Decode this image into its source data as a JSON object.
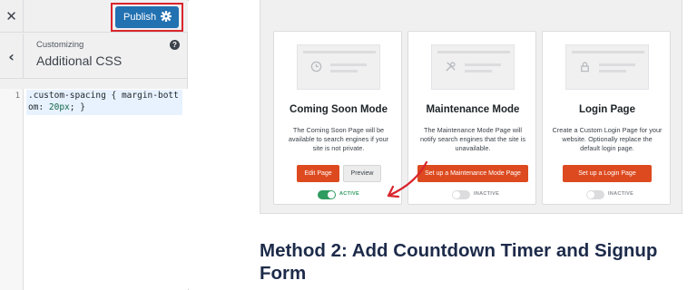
{
  "customizer": {
    "close_icon": "close-icon",
    "publish_label": "Publish",
    "publish_gear_icon": "gear-icon",
    "back_icon": "chevron-left-icon",
    "section_subtitle": "Customizing",
    "section_title": "Additional CSS",
    "help_icon": "help-icon",
    "help_glyph": "?",
    "editor": {
      "line_number": "1",
      "code_selector": ".custom-spacing",
      "code_open": " { margin-bottom: ",
      "code_value": "20px",
      "code_close": "; }"
    }
  },
  "preview": {
    "cards": [
      {
        "title": "Coming Soon Mode",
        "description": "The Coming Soon Page will be available to search engines if your site is not private.",
        "primary_button": "Edit Page",
        "secondary_button": "Preview",
        "toggle_state": "ACTIVE",
        "placeholder_icon": "clock-icon"
      },
      {
        "title": "Maintenance Mode",
        "description": "The Maintenance Mode Page will notify search engines that the site is unavailable.",
        "primary_button": "Set up a Maintenance Mode Page",
        "toggle_state": "INACTIVE",
        "placeholder_icon": "tools-icon"
      },
      {
        "title": "Login Page",
        "description": "Create a Custom Login Page for your website. Optionally replace the default login page.",
        "primary_button": "Set up a Login Page",
        "toggle_state": "INACTIVE",
        "placeholder_icon": "lock-icon"
      }
    ],
    "heading": "Method 2: Add Countdown Timer and Signup Form"
  },
  "colors": {
    "publish_blue": "#2271b1",
    "highlight_red": "#d9252c",
    "button_orange": "#dd4a1f",
    "toggle_active": "#2e9b5f",
    "toggle_inactive": "#dcdcde",
    "heading_navy": "#1d2b4a"
  }
}
